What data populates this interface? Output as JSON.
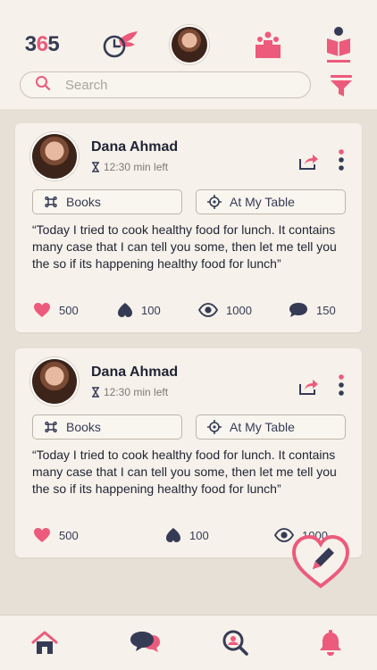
{
  "header": {
    "logo_part1": "3",
    "logo_part2": "6",
    "logo_part3": "5",
    "search_placeholder": "Search"
  },
  "posts": [
    {
      "author": "Dana Ahmad",
      "time_left": "12:30 min left",
      "tag_1": "Books",
      "tag_2": "At My Table",
      "text": "“Today I tried to cook healthy food for lunch. It contains many case that I can tell you some, then let me tell you the so if its happening healthy food for lunch”",
      "likes": "500",
      "upvotes": "100",
      "views": "1000",
      "comments": "150"
    },
    {
      "author": "Dana Ahmad",
      "time_left": "12:30 min left",
      "tag_1": "Books",
      "tag_2": "At My Table",
      "text": "“Today I tried to cook healthy food for lunch. It contains many case that I can tell you some, then let me tell you the so if its happening healthy food for lunch”",
      "likes": "500",
      "upvotes": "100",
      "views": "1000"
    }
  ],
  "colors": {
    "accent_pink": "#ec5a7c",
    "navy": "#363b55",
    "background": "#e6e0d6",
    "card": "#f6f1ea"
  },
  "icons": {
    "top_nav": [
      "logo-365",
      "clock-wing-icon",
      "avatar",
      "group-podium-icon",
      "reader-icon"
    ],
    "bottom_nav": [
      "home-icon",
      "chat-icon",
      "search-person-icon",
      "bell-icon"
    ],
    "fab": "heart-edit-icon"
  }
}
